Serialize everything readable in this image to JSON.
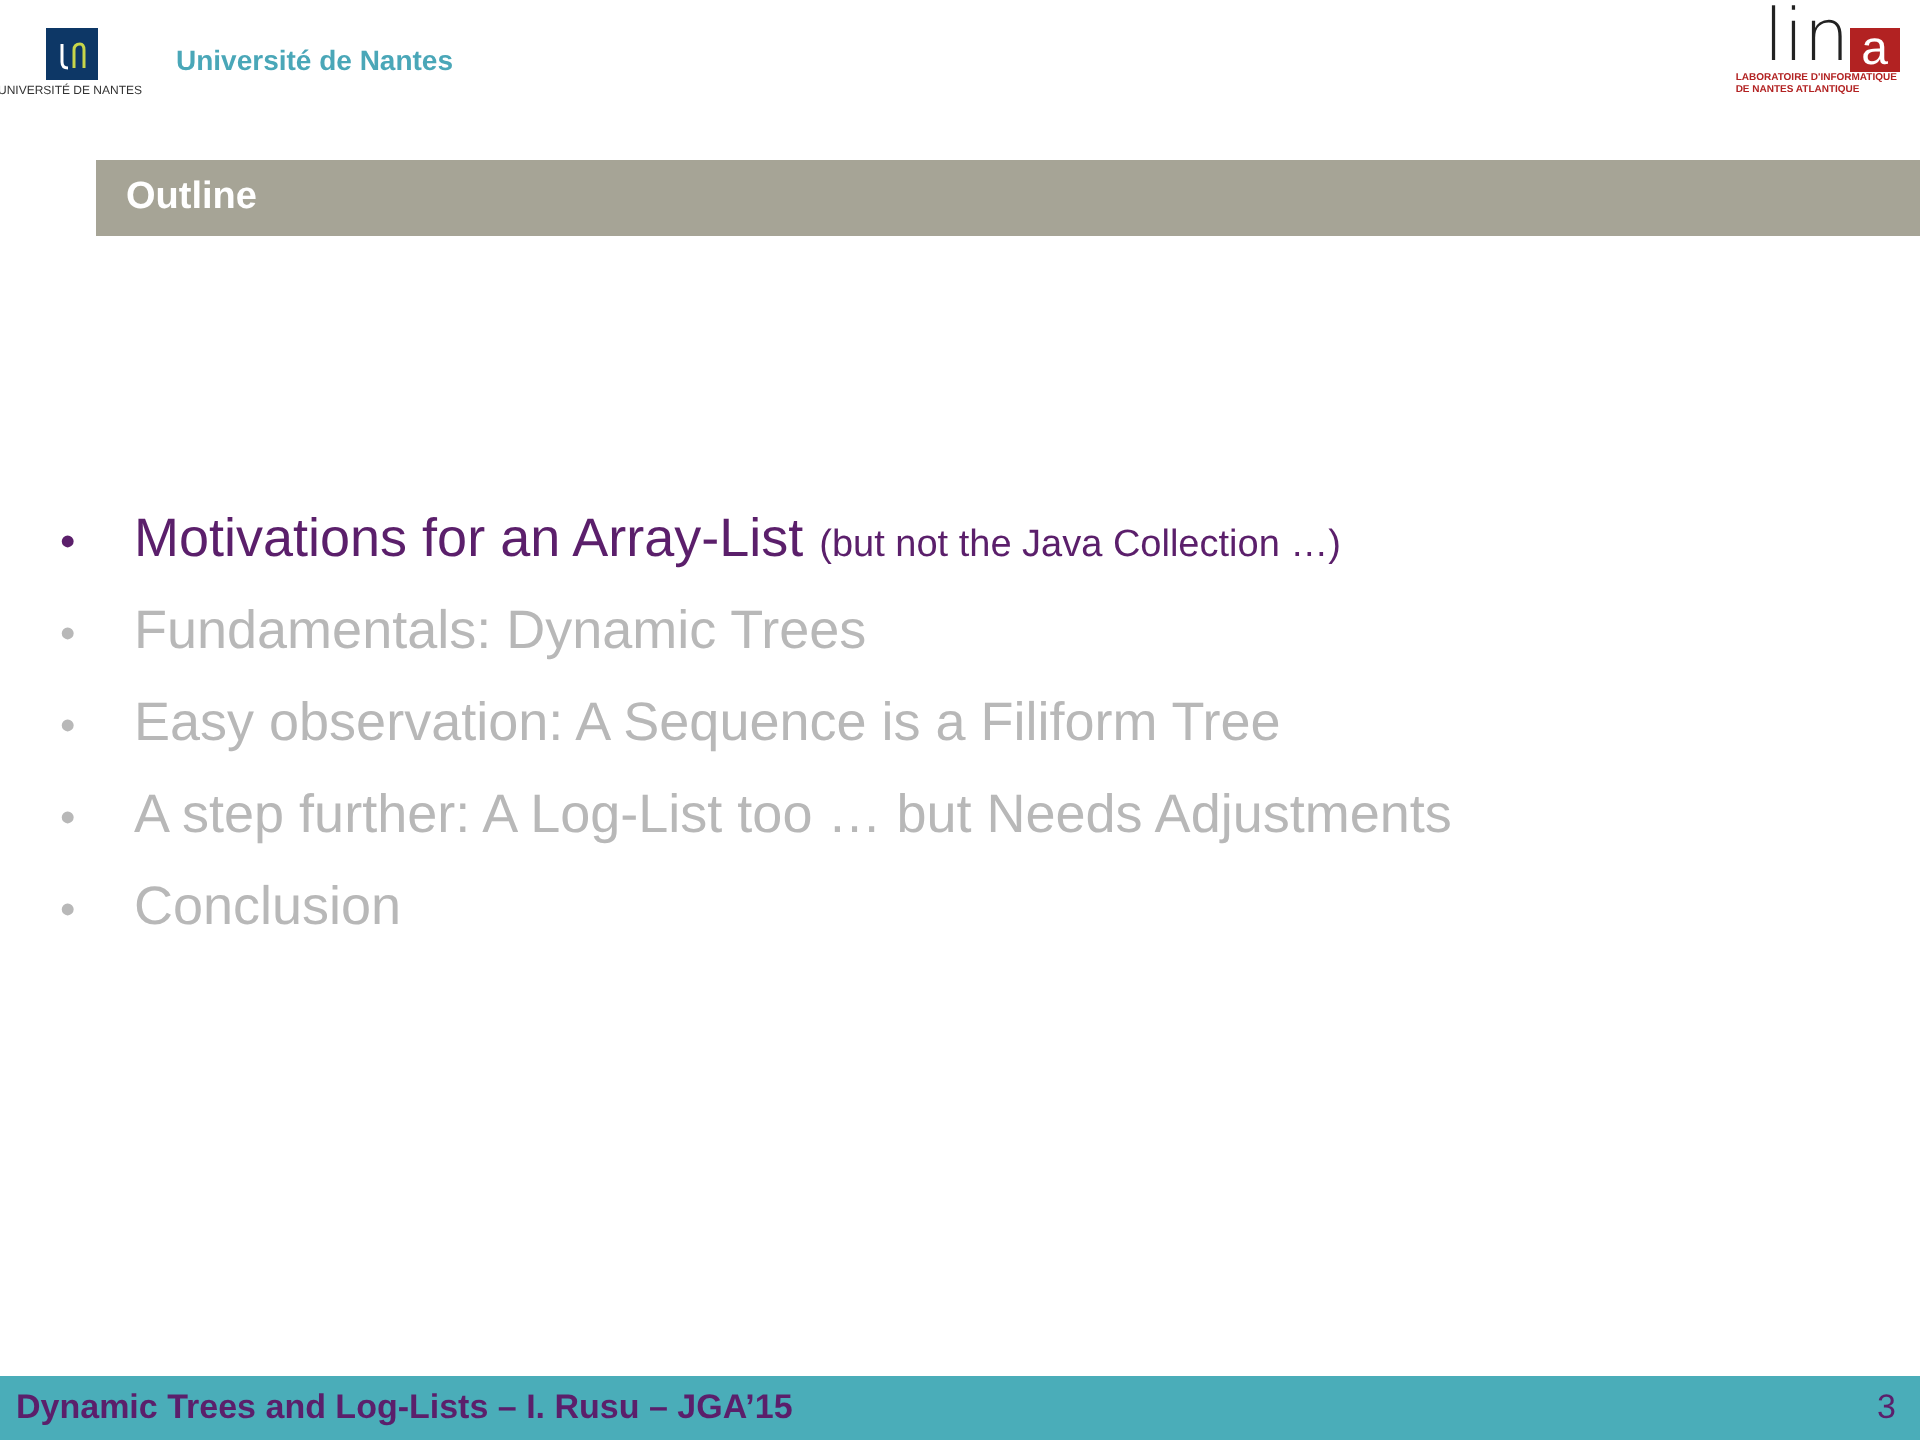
{
  "header": {
    "university_caption": "UNIVERSITÉ DE NANTES",
    "university_name": "Université de Nantes",
    "lab_logo_letters": "lin",
    "lab_logo_box_letter": "a",
    "lab_caption": [
      "LABORATOIRE D'INFORMATIQUE",
      "DE NANTES ATLANTIQUE"
    ]
  },
  "title": "Outline",
  "items": [
    {
      "bullet": "•",
      "text": "Motivations for an Array-List",
      "note": "(but not the Java Collection …)",
      "current": true
    },
    {
      "bullet": "•",
      "text": "Fundamentals: Dynamic Trees",
      "current": false
    },
    {
      "bullet": "•",
      "text": "Easy observation: A Sequence is a Filiform Tree",
      "current": false
    },
    {
      "bullet": "•",
      "text": "A step further: A Log-List too … but Needs Adjustments",
      "current": false
    },
    {
      "bullet": "•",
      "text": "Conclusion",
      "current": false
    }
  ],
  "footer": {
    "text": "Dynamic Trees and Log-Lists – I. Rusu – JGA’15",
    "page": "3"
  }
}
